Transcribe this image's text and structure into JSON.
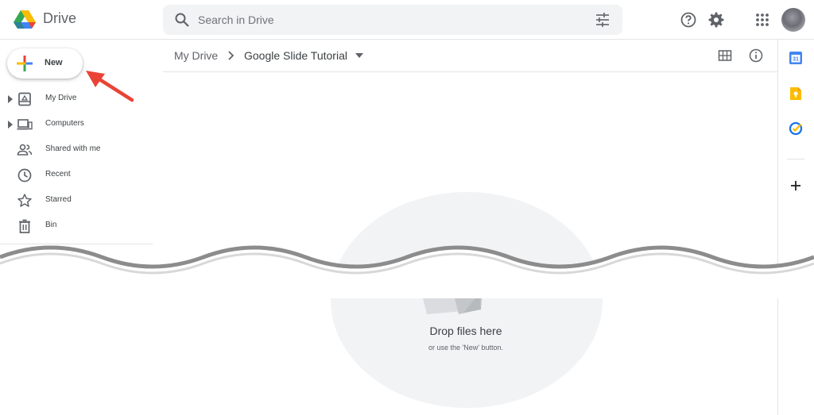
{
  "header": {
    "app_name": "Drive",
    "search_placeholder": "Search in Drive",
    "icons": [
      "google-drive-logo",
      "search-icon",
      "tune-icon",
      "help-icon",
      "gear-icon",
      "apps-grid-icon",
      "avatar"
    ]
  },
  "sidebar": {
    "new_label": "New",
    "items": [
      {
        "label": "My Drive",
        "icon": "my-drive-icon",
        "expandable": true
      },
      {
        "label": "Computers",
        "icon": "computers-icon",
        "expandable": true
      },
      {
        "label": "Shared with me",
        "icon": "shared-icon",
        "expandable": false
      },
      {
        "label": "Recent",
        "icon": "clock-icon",
        "expandable": false
      },
      {
        "label": "Starred",
        "icon": "star-icon",
        "expandable": false
      },
      {
        "label": "Bin",
        "icon": "trash-icon",
        "expandable": false
      }
    ]
  },
  "main": {
    "breadcrumb": {
      "root": "My Drive",
      "current": "Google Slide Tutorial"
    },
    "empty_state": {
      "title": "Drop files here",
      "subtitle": "or use the 'New' button."
    },
    "view_icons": [
      "grid-view-icon",
      "info-icon"
    ]
  },
  "right_rail": {
    "apps": [
      "calendar-icon",
      "keep-icon",
      "tasks-icon",
      "add-icon"
    ],
    "calendar_day": "31"
  },
  "colors": {
    "blue": "#4285f4",
    "red": "#ea4335",
    "yellow": "#fbbc04",
    "green": "#34a853",
    "annotation_arrow": "#ea4335",
    "empty_circle": "#f1f3f4"
  }
}
